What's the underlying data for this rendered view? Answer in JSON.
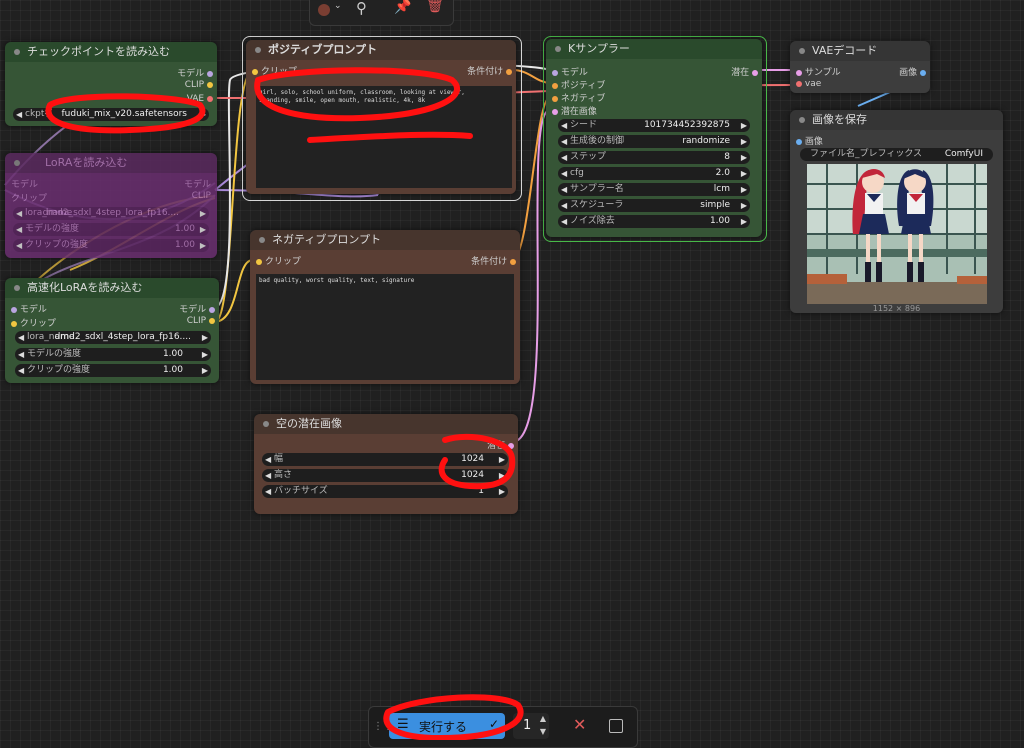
{
  "top_toolbar": {
    "color_icon": "color-circle-icon",
    "wand_icon": "wand-icon",
    "pin_icon": "pin-icon",
    "trash_icon": "trash-icon"
  },
  "checkpoint": {
    "title": "チェックポイントを読み込む",
    "outputs": [
      "モデル",
      "CLIP",
      "VAE"
    ],
    "ckpt_label": "ckpt名",
    "ckpt_value": "fuduki_mix_v20.safetensors"
  },
  "lora_bypassed": {
    "title": "LoRAを読み込む",
    "in_model": "モデル",
    "in_clip": "クリップ",
    "out_model": "モデル",
    "out_clip": "CLIP",
    "lora_label": "lora_name",
    "lora_value": "dmd2_sdxl_4step_lora_fp16....",
    "model_strength_label": "モデルの強度",
    "model_strength_value": "1.00",
    "clip_strength_label": "クリップの強度",
    "clip_strength_value": "1.00"
  },
  "lora_fast": {
    "title": "高速化LoRAを読み込む",
    "in_model": "モデル",
    "in_clip": "クリップ",
    "out_model": "モデル",
    "out_clip": "CLIP",
    "lora_label": "lora_name",
    "lora_value": "dmd2_sdxl_4step_lora_fp16....",
    "model_strength_label": "モデルの強度",
    "model_strength_value": "1.00",
    "clip_strength_label": "クリップの強度",
    "clip_strength_value": "1.00"
  },
  "positive": {
    "title": "ポジティブプロンプト",
    "in_clip": "クリップ",
    "out_cond": "条件付け",
    "text": "girl, solo, school uniform, classroom, looking at viewer,\nstanding, smile, open mouth, realistic, 4k, 8k"
  },
  "negative": {
    "title": "ネガティブプロンプト",
    "in_clip": "クリップ",
    "out_cond": "条件付け",
    "text": "bad quality, worst quality, text, signature"
  },
  "latent": {
    "title": "空の潜在画像",
    "out_latent": "潜在",
    "width_label": "幅",
    "width_value": "1024",
    "height_label": "高さ",
    "height_value": "1024",
    "batch_label": "バッチサイズ",
    "batch_value": "1"
  },
  "ksampler": {
    "title": "Kサンプラー",
    "in_model": "モデル",
    "in_positive": "ポジティブ",
    "in_negative": "ネガティブ",
    "in_latent": "潜在画像",
    "out_latent": "潜在",
    "widgets": [
      {
        "label": "シード",
        "value": "101734452392875"
      },
      {
        "label": "生成後の制御",
        "value": "randomize"
      },
      {
        "label": "ステップ",
        "value": "8"
      },
      {
        "label": "cfg",
        "value": "2.0"
      },
      {
        "label": "サンプラー名",
        "value": "lcm"
      },
      {
        "label": "スケジューラ",
        "value": "simple"
      },
      {
        "label": "ノイズ除去",
        "value": "1.00"
      }
    ]
  },
  "vae_decode": {
    "title": "VAEデコード",
    "in_samples": "サンプル",
    "in_vae": "vae",
    "out_image": "画像"
  },
  "save_image": {
    "title": "画像を保存",
    "in_images": "画像",
    "prefix_label": "ファイル名_プレフィックス",
    "prefix_value": "ComfyUI",
    "image_size": "1152 × 896"
  },
  "run_bar": {
    "run_label": "実行する",
    "count_value": "1"
  }
}
